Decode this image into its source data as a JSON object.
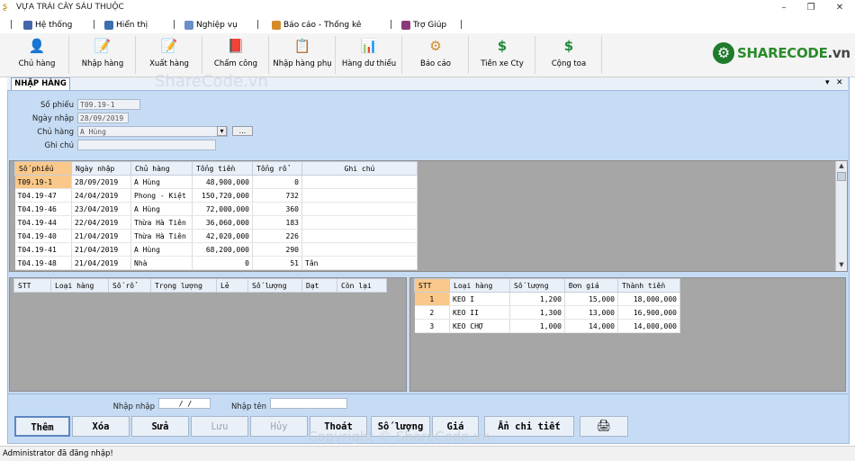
{
  "window": {
    "title": "VỰA TRÁI CÂY SÁU THUỘC",
    "minimize": "–",
    "restore": "❐",
    "close": "✕"
  },
  "menu": [
    {
      "label": "Hệ thống",
      "icon": "system-icon",
      "color": "#4466aa"
    },
    {
      "label": "Hiển thị",
      "icon": "display-icon",
      "color": "#3a6fb0"
    },
    {
      "label": "Nghiệp vụ",
      "icon": "business-icon",
      "color": "#6a8fcc"
    },
    {
      "label": "Báo cáo - Thống kê",
      "icon": "report-icon",
      "color": "#d48a2a"
    },
    {
      "label": "Trợ Giúp",
      "icon": "help-icon",
      "color": "#8a3a7a"
    }
  ],
  "toolbar": [
    {
      "label": "Chủ hàng",
      "icon": "user-icon",
      "glyph": "👤",
      "color": "#3f7fd1"
    },
    {
      "label": "Nhập hàng",
      "icon": "import-icon",
      "glyph": "📝",
      "color": "#5a78b0"
    },
    {
      "label": "Xuất hàng",
      "icon": "export-icon",
      "glyph": "📝",
      "color": "#5a78b0"
    },
    {
      "label": "Chấm công",
      "icon": "attendance-icon",
      "glyph": "📕",
      "color": "#c0392b"
    },
    {
      "label": "Nhập hàng phụ",
      "icon": "sub-import-icon",
      "glyph": "📋",
      "color": "#c08a2a"
    },
    {
      "label": "Hàng dư thiếu",
      "icon": "chart-icon",
      "glyph": "📊",
      "color": "#2c6fb0"
    },
    {
      "label": "Báo cáo",
      "icon": "report-icon",
      "glyph": "⚙",
      "color": "#d48a2a"
    },
    {
      "label": "Tiền xe Cty",
      "icon": "money-icon",
      "glyph": "$",
      "color": "#1e8a3a"
    },
    {
      "label": "Cộng toa",
      "icon": "money-icon",
      "glyph": "$",
      "color": "#1e8a3a"
    }
  ],
  "brand": {
    "part1": "SHARECODE",
    "part2": ".vn"
  },
  "watermarks": {
    "top": "ShareCode.vn",
    "bottom": "Copyright © ShareCode.vn"
  },
  "tab": {
    "label": "NHẬP HÀNG",
    "dropdown": "▾",
    "close": "✕"
  },
  "form": {
    "so_phieu": {
      "label": "Số phiếu",
      "value": "T09.19-1"
    },
    "ngay_nhap": {
      "label": "Ngày nhập",
      "value": "28/09/2019"
    },
    "chu_hang": {
      "label": "Chủ hàng",
      "value": "A Hùng",
      "dropdown": "▾",
      "more": "..."
    },
    "ghi_chu": {
      "label": "Ghi chú",
      "value": ""
    }
  },
  "master_table": {
    "columns": [
      "Số phiếu",
      "Ngày nhập",
      "Chủ hàng",
      "Tổng tiền",
      "Tổng rổ",
      "Ghi chú"
    ],
    "rows": [
      [
        "T09.19-1",
        "28/09/2019",
        "A Hùng",
        "48,900,000",
        "0",
        ""
      ],
      [
        "T04.19-47",
        "24/04/2019",
        "Phong - Kiệt",
        "150,720,000",
        "732",
        ""
      ],
      [
        "T04.19-46",
        "23/04/2019",
        "A Hùng",
        "72,000,000",
        "360",
        ""
      ],
      [
        "T04.19-44",
        "22/04/2019",
        "Thừa Hà Tiên",
        "36,060,000",
        "183",
        ""
      ],
      [
        "T04.19-40",
        "21/04/2019",
        "Thừa Hà Tiên",
        "42,020,000",
        "226",
        ""
      ],
      [
        "T04.19-41",
        "21/04/2019",
        "A Hùng",
        "68,200,000",
        "290",
        ""
      ],
      [
        "T04.19-48",
        "21/04/2019",
        "Nhà",
        "0",
        "51",
        "Tân"
      ]
    ]
  },
  "left_detail": {
    "columns": [
      "STT",
      "Loại hàng",
      "Số rổ",
      "Trọng lượng",
      "Lẻ",
      "Số lượng",
      "Dạt",
      "Còn lại"
    ]
  },
  "right_detail": {
    "columns": [
      "STT",
      "Loại hàng",
      "Số lượng",
      "Đơn giá",
      "Thành tiền"
    ],
    "rows": [
      [
        "1",
        "KEO I",
        "1,200",
        "15,000",
        "18,000,000"
      ],
      [
        "2",
        "KEO II",
        "1,300",
        "13,000",
        "16,900,000"
      ],
      [
        "3",
        "KEO CHỢ",
        "1,000",
        "14,000",
        "14,000,000"
      ]
    ]
  },
  "filters": {
    "nhap_nhap": {
      "label": "Nhập nhập",
      "value": "/ /"
    },
    "nhap_ten": {
      "label": "Nhập tên",
      "value": ""
    }
  },
  "actions": [
    {
      "label": "Thêm",
      "enabled": true,
      "name": "add-button"
    },
    {
      "label": "Xóa",
      "enabled": true,
      "name": "delete-button"
    },
    {
      "label": "Sửa",
      "enabled": true,
      "name": "edit-button"
    },
    {
      "label": "Lưu",
      "enabled": false,
      "name": "save-button"
    },
    {
      "label": "Hủy",
      "enabled": false,
      "name": "cancel-button"
    },
    {
      "label": "Thoát",
      "enabled": true,
      "name": "exit-button"
    },
    {
      "label": "Số lượng",
      "enabled": true,
      "name": "quantity-button"
    },
    {
      "label": "Giá",
      "enabled": true,
      "name": "price-button"
    },
    {
      "label": "Ẩn chi tiết",
      "enabled": true,
      "name": "hide-detail-button"
    },
    {
      "label": "",
      "enabled": true,
      "name": "print-button",
      "icon": "printer-icon",
      "glyph": "🖨"
    }
  ],
  "status": "Administrator đã đăng nhập!"
}
